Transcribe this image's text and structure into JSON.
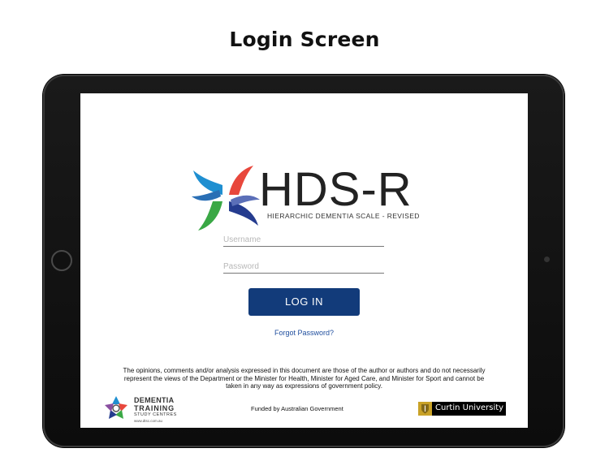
{
  "caption": "Login Screen",
  "app": {
    "title": "HDS-R",
    "subtitle": "HIERARCHIC DEMENTIA SCALE - REVISED"
  },
  "login": {
    "username_placeholder": "Username",
    "username_value": "",
    "password_placeholder": "Password",
    "password_value": "",
    "button_label": "LOG IN",
    "forgot_label": "Forgot Password?"
  },
  "footer": {
    "disclaimer": "The opinions, comments and/or analysis expressed in this document are those of the author or authors and do not necessarily represent the views of the Department or the Minister for Health, Minister for Aged Care, and Minister for Sport and cannot be taken in any way as expressions of government policy.",
    "dtsc": {
      "line1": "DEMENTIA",
      "line2": "TRAINING",
      "line3": "STUDY CENTRES",
      "url": "www.dtsc.com.au"
    },
    "funded": "Funded by Australian Government",
    "curtin": "Curtin University"
  },
  "colors": {
    "button": "#123b7a",
    "link": "#1f4e9e",
    "logo_red": "#e8473c",
    "logo_blue": "#1f8fd1",
    "logo_green": "#3aa845",
    "logo_navy": "#253c8f",
    "curtin_gold": "#c9a227"
  },
  "icons": {
    "logo": "pinwheel-icon",
    "dtsc": "star-flower-icon",
    "curtin": "crest-icon"
  }
}
